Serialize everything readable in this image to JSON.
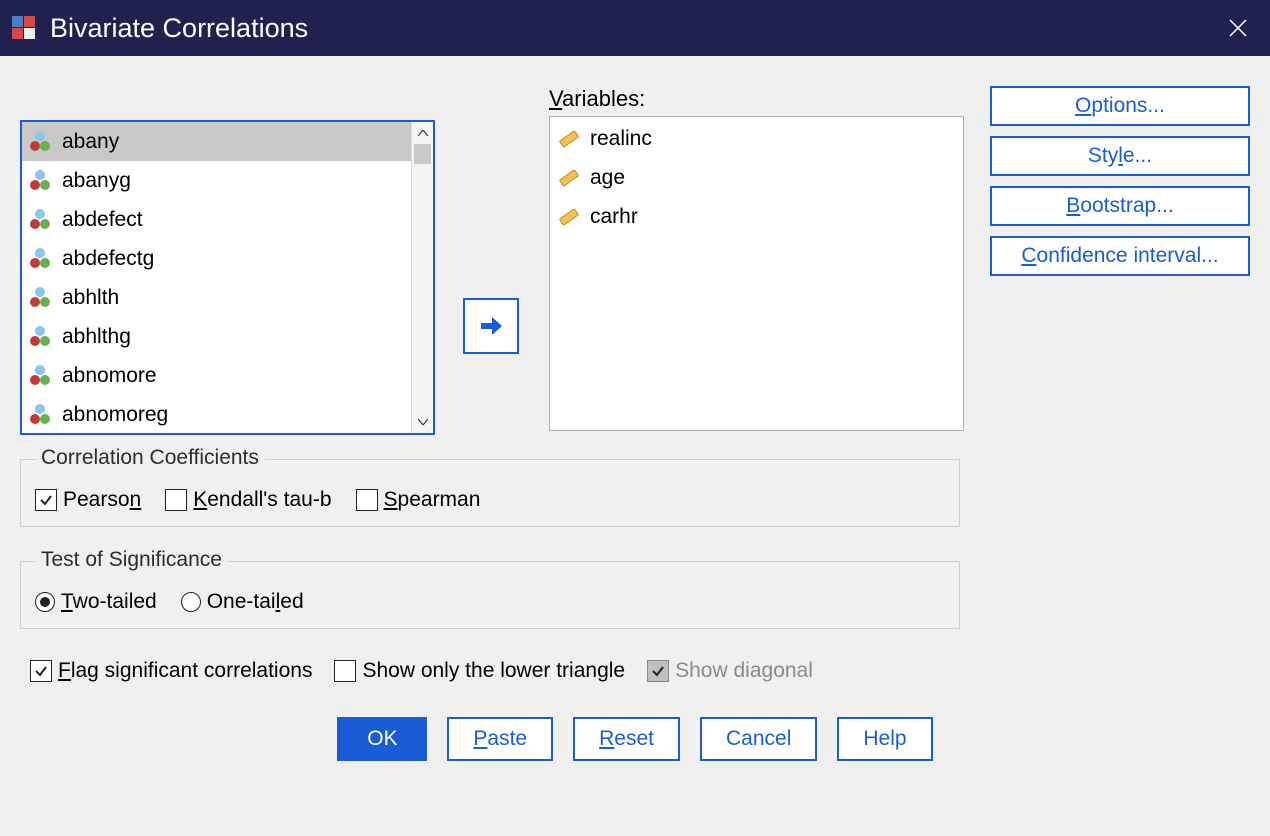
{
  "title": "Bivariate Correlations",
  "side_buttons": [
    {
      "label": "Options...",
      "key": "O"
    },
    {
      "label": "Style...",
      "key": "l"
    },
    {
      "label": "Bootstrap...",
      "key": "B"
    },
    {
      "label": "Confidence interval...",
      "key": "C"
    }
  ],
  "source_vars": [
    "abany",
    "abanyg",
    "abdefect",
    "abdefectg",
    "abhlth",
    "abhlthg",
    "abnomore",
    "abnomoreg"
  ],
  "selected_source_index": 0,
  "variables_label_pre": "V",
  "variables_label_post": "ariables:",
  "target_vars": [
    "realinc",
    "age",
    "carhr"
  ],
  "group_coeff": {
    "label": "Correlation Coefficients",
    "items": [
      {
        "label_pre": "Pearso",
        "ul": "n",
        "label_post": "",
        "checked": true
      },
      {
        "label_pre": "",
        "ul": "K",
        "label_post": "endall's tau-b",
        "checked": false
      },
      {
        "label_pre": "",
        "ul": "S",
        "label_post": "pearman",
        "checked": false
      }
    ]
  },
  "group_sig": {
    "label": "Test of Significance",
    "items": [
      {
        "label_pre": "",
        "ul": "T",
        "label_post": "wo-tailed",
        "selected": true
      },
      {
        "label_pre": "One-tai",
        "ul": "l",
        "label_post": "ed",
        "selected": false
      }
    ]
  },
  "bottom_checks": [
    {
      "label_pre": "",
      "ul": "F",
      "label_post": "lag significant correlations",
      "checked": true,
      "disabled": false
    },
    {
      "label_pre": "Show only the lower trian",
      "ul": "g",
      "label_post": "le",
      "checked": false,
      "disabled": false
    },
    {
      "label_pre": "Show diagonal",
      "ul": "",
      "label_post": "",
      "checked": true,
      "disabled": true
    }
  ],
  "buttons": {
    "ok": "OK",
    "paste_pre": "",
    "paste_ul": "P",
    "paste_post": "aste",
    "reset_pre": "",
    "reset_ul": "R",
    "reset_post": "eset",
    "cancel": "Cancel",
    "help": "Help"
  }
}
